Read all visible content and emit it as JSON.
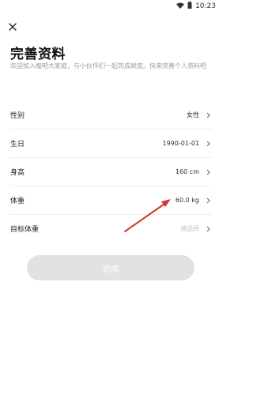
{
  "status_bar": {
    "time": "10:23",
    "icons": [
      "wifi-icon",
      "battery-icon"
    ]
  },
  "header": {
    "close_icon": "close-icon",
    "title": "完善资料",
    "subtitle": "欢迎加入瘦吧大家庭，与小伙伴们一起完成蜕变。快来完善个人资料吧"
  },
  "form": {
    "rows": [
      {
        "label": "性别",
        "value": "女性",
        "is_placeholder": false
      },
      {
        "label": "生日",
        "value": "1990-01-01",
        "is_placeholder": false
      },
      {
        "label": "身高",
        "value": "160 cm",
        "is_placeholder": false
      },
      {
        "label": "体重",
        "value": "60.0 kg",
        "is_placeholder": false
      },
      {
        "label": "目标体重",
        "value": "请选择",
        "is_placeholder": true
      }
    ]
  },
  "actions": {
    "submit_label": "完成",
    "submit_enabled": false
  },
  "colors": {
    "annotation_arrow": "#d9362b",
    "button_disabled_bg": "#e2e2e2",
    "placeholder_text": "#c2c2c2"
  }
}
